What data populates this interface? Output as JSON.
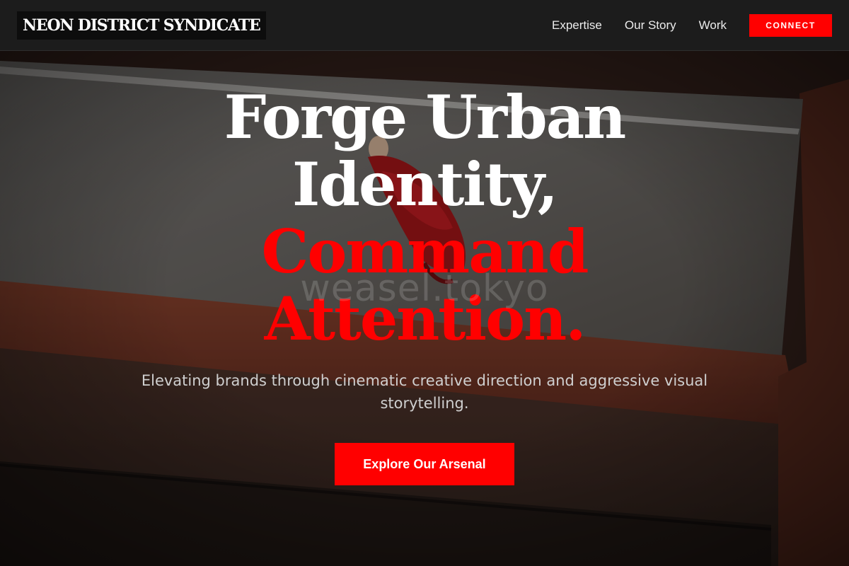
{
  "header": {
    "brand_name": "NEON DISTRICT SYNDICATE",
    "nav_items": [
      {
        "label": "Expertise"
      },
      {
        "label": "Our Story"
      },
      {
        "label": "Work"
      }
    ],
    "connect_label": "CONNECT"
  },
  "hero": {
    "headline_lines": [
      "Forge Urban",
      "Identity,",
      "Command",
      "Attention."
    ],
    "watermark": "weasel.tokyo",
    "subtitle": "Elevating brands through cinematic creative direction and aggressive visual storytelling.",
    "cta_label": "Explore Our Arsenal"
  },
  "colors": {
    "accent": "#ff0000",
    "header_bg": "#1c1c1c",
    "brand_bg": "#0d0d0d",
    "text_primary": "#ffffff",
    "text_secondary": "#cfcfcf"
  }
}
